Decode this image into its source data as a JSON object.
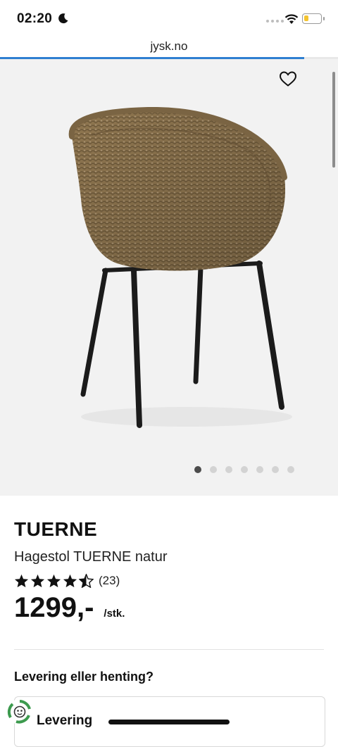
{
  "status_bar": {
    "time": "02:20"
  },
  "browser": {
    "url": "jysk.no",
    "load_progress_percent": 90
  },
  "gallery": {
    "image_count": 7,
    "active_index": 0
  },
  "product": {
    "name": "TUERNE",
    "subtitle": "Hagestol TUERNE natur",
    "rating_stars": 4.5,
    "review_count": "(23)",
    "price": "1299,-",
    "unit": "/stk."
  },
  "delivery": {
    "heading": "Levering eller henting?",
    "option_label": "Levering"
  },
  "colors": {
    "accent": "#2f7fd1",
    "battery": "#f4c430"
  }
}
